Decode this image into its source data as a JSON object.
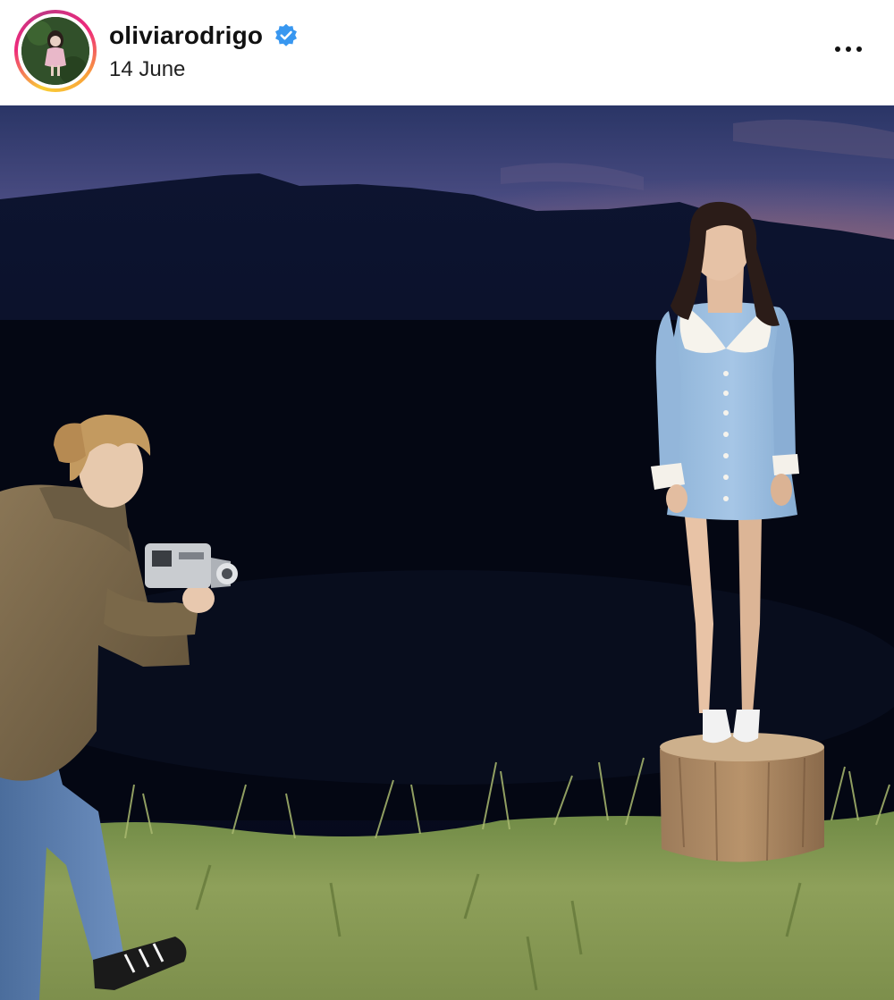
{
  "post": {
    "username": "oliviarodrigo",
    "date": "14 June"
  },
  "icons": {
    "verified": "verified-badge-icon",
    "more": "more-options-icon"
  },
  "colors": {
    "verified_blue": "#3897f0",
    "text_primary": "#111111"
  }
}
